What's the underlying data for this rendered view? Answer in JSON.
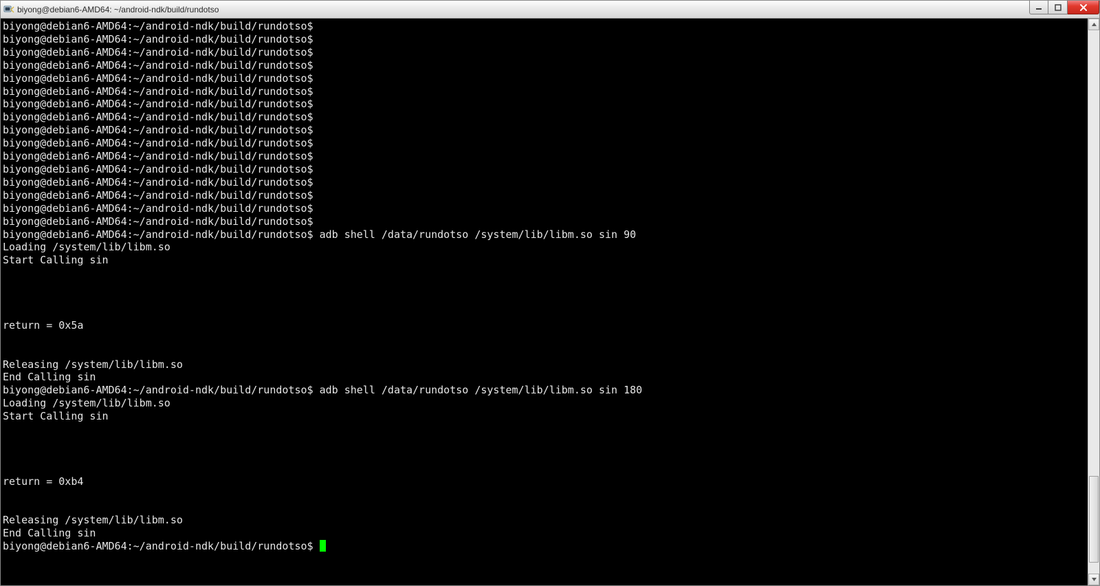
{
  "window": {
    "title": "biyong@debian6-AMD64: ~/android-ndk/build/rundotso"
  },
  "prompt": "biyong@debian6-AMD64:~/android-ndk/build/rundotso$",
  "lines": [
    "biyong@debian6-AMD64:~/android-ndk/build/rundotso$",
    "biyong@debian6-AMD64:~/android-ndk/build/rundotso$",
    "biyong@debian6-AMD64:~/android-ndk/build/rundotso$",
    "biyong@debian6-AMD64:~/android-ndk/build/rundotso$",
    "biyong@debian6-AMD64:~/android-ndk/build/rundotso$",
    "biyong@debian6-AMD64:~/android-ndk/build/rundotso$",
    "biyong@debian6-AMD64:~/android-ndk/build/rundotso$",
    "biyong@debian6-AMD64:~/android-ndk/build/rundotso$",
    "biyong@debian6-AMD64:~/android-ndk/build/rundotso$",
    "biyong@debian6-AMD64:~/android-ndk/build/rundotso$",
    "biyong@debian6-AMD64:~/android-ndk/build/rundotso$",
    "biyong@debian6-AMD64:~/android-ndk/build/rundotso$",
    "biyong@debian6-AMD64:~/android-ndk/build/rundotso$",
    "biyong@debian6-AMD64:~/android-ndk/build/rundotso$",
    "biyong@debian6-AMD64:~/android-ndk/build/rundotso$",
    "biyong@debian6-AMD64:~/android-ndk/build/rundotso$",
    "biyong@debian6-AMD64:~/android-ndk/build/rundotso$ adb shell /data/rundotso /system/lib/libm.so sin 90",
    "Loading /system/lib/libm.so",
    "Start Calling sin",
    "",
    "",
    "",
    "",
    "return = 0x5a",
    "",
    "",
    "Releasing /system/lib/libm.so",
    "End Calling sin",
    "biyong@debian6-AMD64:~/android-ndk/build/rundotso$ adb shell /data/rundotso /system/lib/libm.so sin 180",
    "Loading /system/lib/libm.so",
    "Start Calling sin",
    "",
    "",
    "",
    "",
    "return = 0xb4",
    "",
    "",
    "Releasing /system/lib/libm.so",
    "End Calling sin"
  ],
  "scrollbar": {
    "thumb_top_pct": 82,
    "thumb_height_pct": 16
  }
}
